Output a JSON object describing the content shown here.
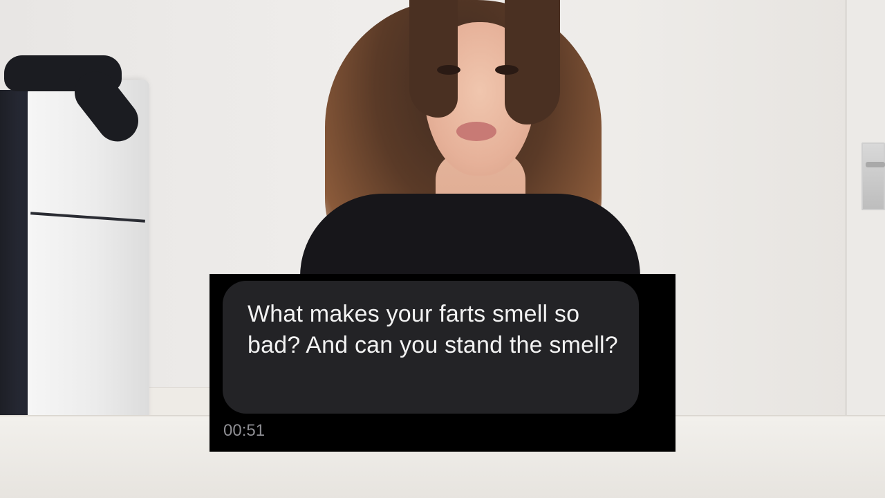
{
  "message": {
    "text": "What makes your farts smell so bad? And can you stand the smell?",
    "timestamp": "00:51"
  },
  "colors": {
    "card_background": "#000000",
    "bubble_background": "#232326",
    "message_text": "#f2f2f2",
    "timestamp_text": "#8e8e93"
  }
}
